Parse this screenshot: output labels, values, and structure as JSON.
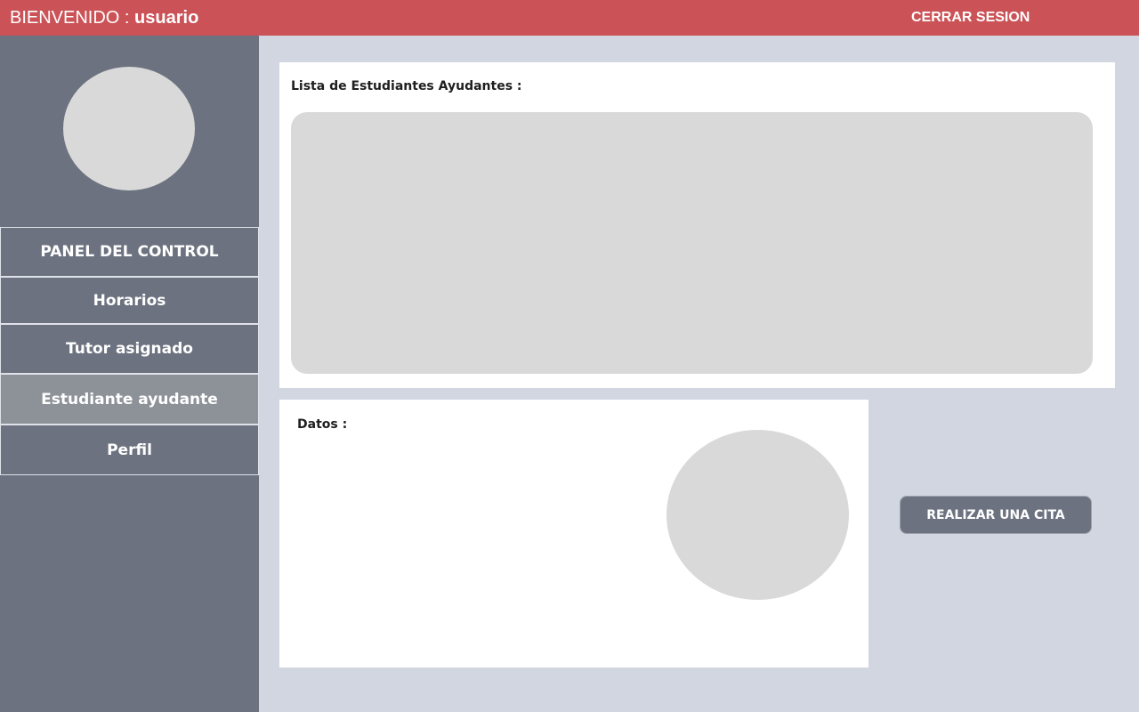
{
  "header": {
    "welcome_label": "BIENVENIDO :",
    "username": "usuario",
    "logout_label": "CERRAR SESION"
  },
  "sidebar": {
    "items": [
      {
        "label": "PANEL DEL CONTROL",
        "active": false
      },
      {
        "label": "Horarios",
        "active": false
      },
      {
        "label": "Tutor asignado",
        "active": false
      },
      {
        "label": "Estudiante ayudante",
        "active": true
      },
      {
        "label": "Perfil",
        "active": false
      }
    ]
  },
  "main": {
    "list_title": "Lista de Estudiantes Ayudantes :",
    "data_title": "Datos :",
    "appointment_button": "REALIZAR UNA CITA"
  },
  "colors": {
    "header_bg": "#cb5357",
    "sidebar_bg": "#6c727f",
    "active_item_bg": "#8d9299",
    "page_bg": "#d1d6e1",
    "placeholder": "#d9d9d9"
  }
}
